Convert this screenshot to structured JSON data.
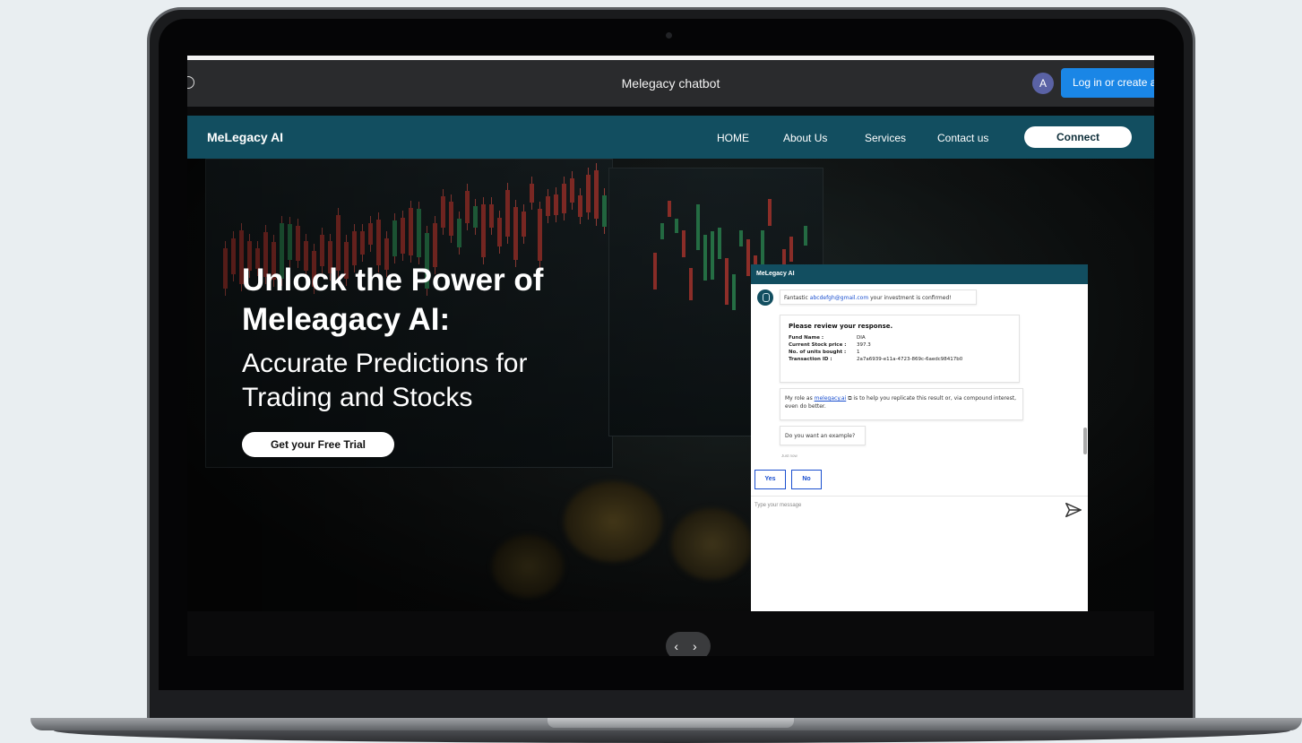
{
  "app_bar": {
    "title": "Melegacy chatbot",
    "avatar_letter": "A",
    "login_label": "Log in or create a"
  },
  "nav": {
    "brand": "MeLegacy AI",
    "links": [
      "HOME",
      "About Us",
      "Services",
      "Contact us"
    ],
    "connect_label": "Connect"
  },
  "hero": {
    "headline_line1": "Unlock the Power of",
    "headline_line2": "Meleagacy AI:",
    "subhead_line1": "Accurate Predictions for",
    "subhead_line2": "Trading and Stocks",
    "cta_label": "Get your Free Trial"
  },
  "chat": {
    "header": "MeLegacy AI",
    "msg1_prefix": "Fantastic",
    "msg1_email": "abcdefgh@gmail.com",
    "msg1_suffix": "your investment is confirmed!",
    "review_title": "Please review your response.",
    "fields": [
      {
        "label": "Fund Name :",
        "value": "DIA"
      },
      {
        "label": "Current Stock price :",
        "value": "397.3"
      },
      {
        "label": "No. of units bought :",
        "value": "1"
      },
      {
        "label": "Transaction ID :",
        "value": "2a7a6939-e11a-4723-869c-6aedc98417b0"
      }
    ],
    "msg3_prefix": "My role as",
    "msg3_link": "melegacy.ai",
    "msg3_suffix": "is to help you replicate this result or, via compound interest, even do better.",
    "msg4": "Do you want an example?",
    "timestamp": "Just now",
    "quick_replies": [
      "Yes",
      "No"
    ],
    "input_placeholder": "Type your message"
  },
  "slider_nav": "‹ ›",
  "colors": {
    "nav_bg": "#124e60",
    "login_btn": "#1a86e6",
    "avatar_bg": "#5a62a5",
    "link_blue": "#1a4fcf"
  }
}
